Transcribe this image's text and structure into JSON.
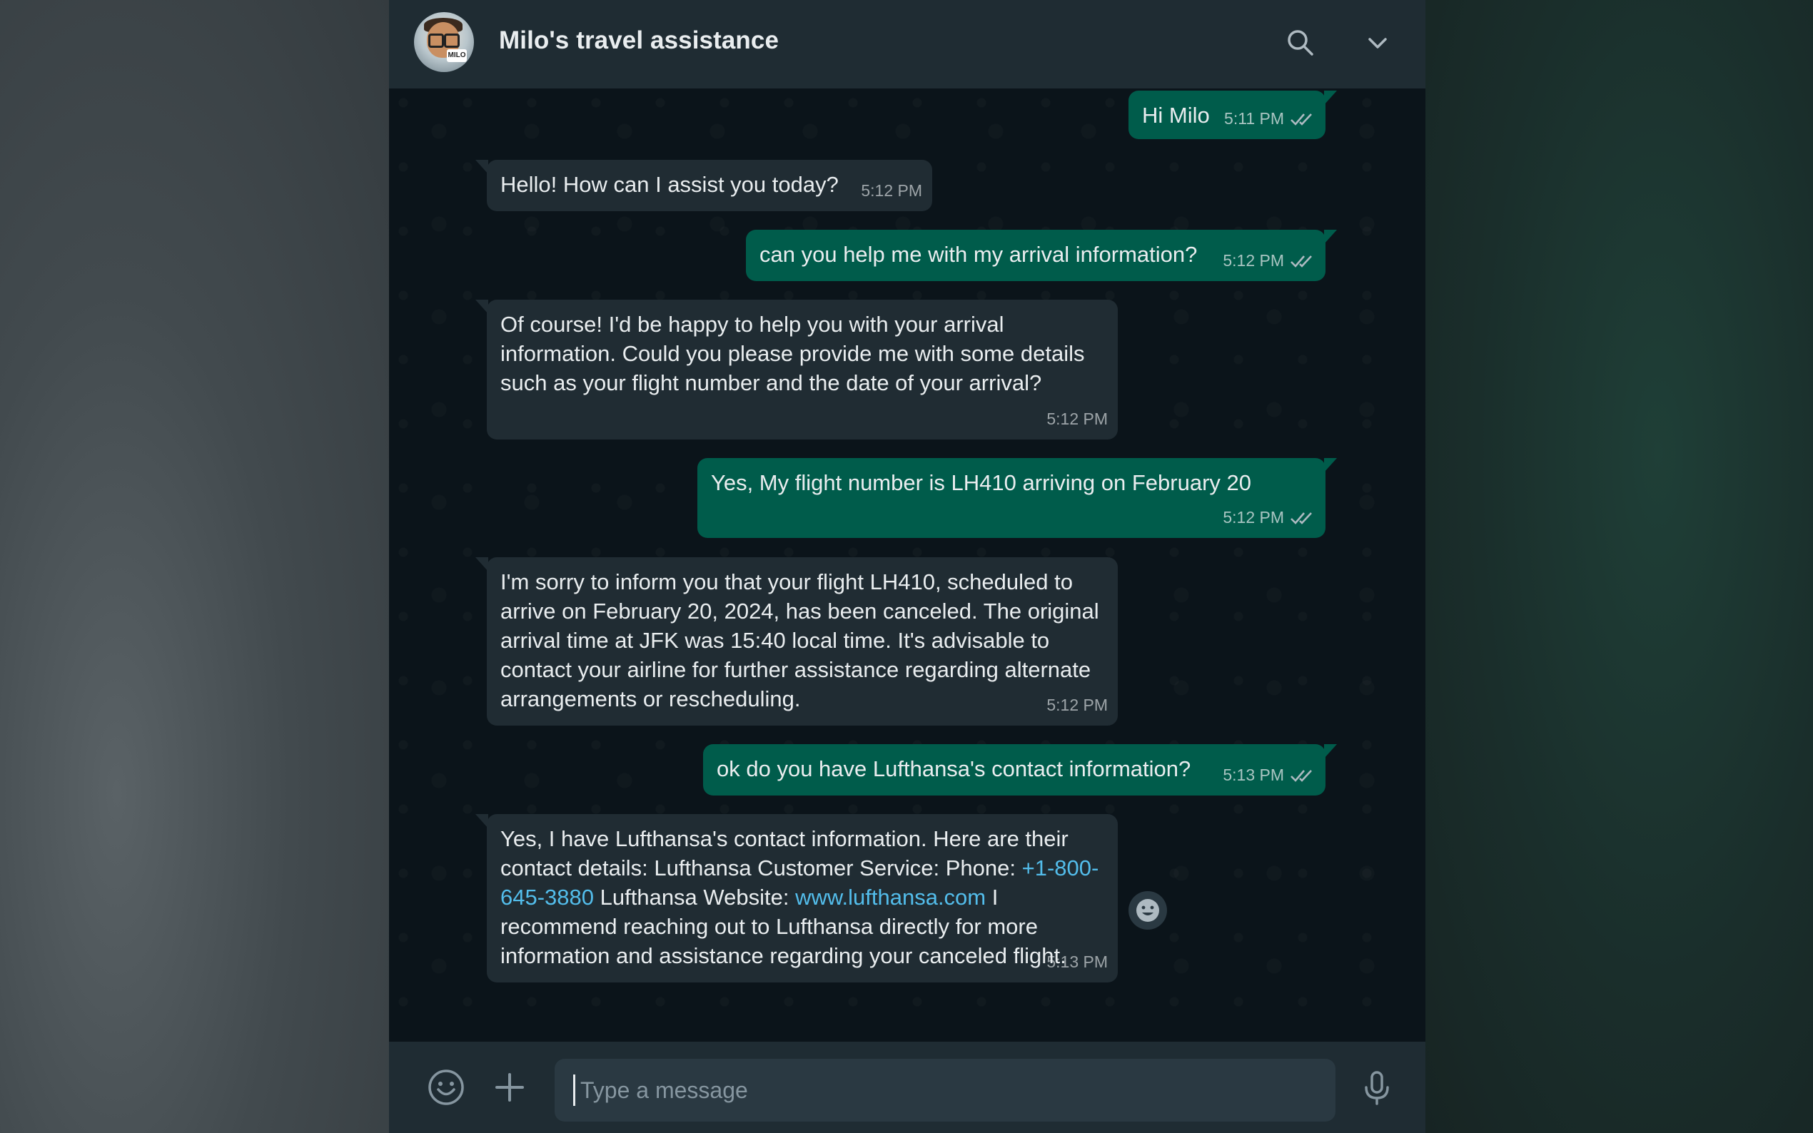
{
  "header": {
    "title": "Milo's travel assistance",
    "avatar_badge": "MILO",
    "search_icon": "search-icon",
    "menu_icon": "chevron-down-icon"
  },
  "messages": [
    {
      "direction": "out",
      "text": "Hi Milo",
      "time": "5:11 PM",
      "status": "read"
    },
    {
      "direction": "in",
      "text": "Hello! How can I assist you today?",
      "time": "5:12 PM"
    },
    {
      "direction": "out",
      "text": "can you help me with my arrival information?",
      "time": "5:12 PM",
      "status": "read"
    },
    {
      "direction": "in",
      "text": "Of course! I'd be happy to help you with your arrival information. Could you please provide me with some details such as your flight number and the date of your arrival?",
      "time": "5:12 PM"
    },
    {
      "direction": "out",
      "text": "Yes, My flight number is LH410 arriving on February 20",
      "time": "5:12 PM",
      "status": "read"
    },
    {
      "direction": "in",
      "text": "I'm sorry to inform you that your flight LH410, scheduled to arrive on February 20, 2024, has been canceled. The original arrival time at JFK was 15:40 local time. It's advisable to contact your airline for further assistance regarding alternate arrangements or rescheduling.",
      "time": "5:12 PM"
    },
    {
      "direction": "out",
      "text": "ok do you have Lufthansa's contact information?",
      "time": "5:13 PM",
      "status": "read"
    },
    {
      "direction": "in",
      "time": "5:13 PM",
      "parts": {
        "p1": "Yes, I have Lufthansa's contact information. Here are their contact details: Lufthansa Customer Service: Phone: ",
        "phone": "+1-800-645-3880",
        "p2": " Lufthansa Website: ",
        "website": "www.lufthansa.com",
        "p3": " I recommend reaching out to Lufthansa directly for more information and assistance regarding your canceled flight."
      }
    }
  ],
  "composer": {
    "placeholder": "Type a message",
    "emoji_icon": "emoji-icon",
    "attach_icon": "plus-icon",
    "mic_icon": "microphone-icon"
  },
  "colors": {
    "incoming_bubble": "#202c33",
    "outgoing_bubble": "#005c4b",
    "link": "#53bdeb",
    "header": "#1f2c33"
  }
}
